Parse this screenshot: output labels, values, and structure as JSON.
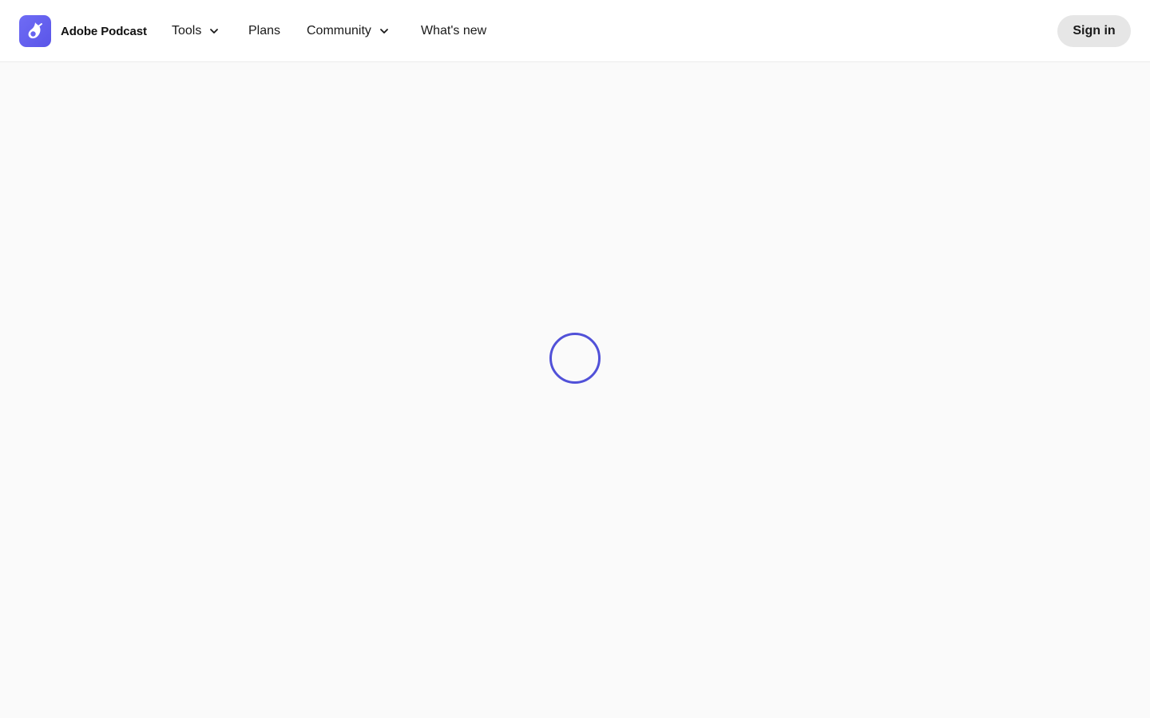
{
  "header": {
    "brand_name": "Adobe Podcast",
    "logo_icon": "adobe-podcast-logo-icon",
    "nav": {
      "tools": "Tools",
      "plans": "Plans",
      "community": "Community",
      "whats_new": "What's new"
    },
    "sign_in_label": "Sign in"
  },
  "colors": {
    "accent": "#5151d8",
    "logo_bg": "#6563f0",
    "page_bg": "#fafafa",
    "header_bg": "#ffffff",
    "sign_in_bg": "#e6e6e6"
  },
  "main": {
    "loading_icon": "loading-spinner-icon"
  }
}
